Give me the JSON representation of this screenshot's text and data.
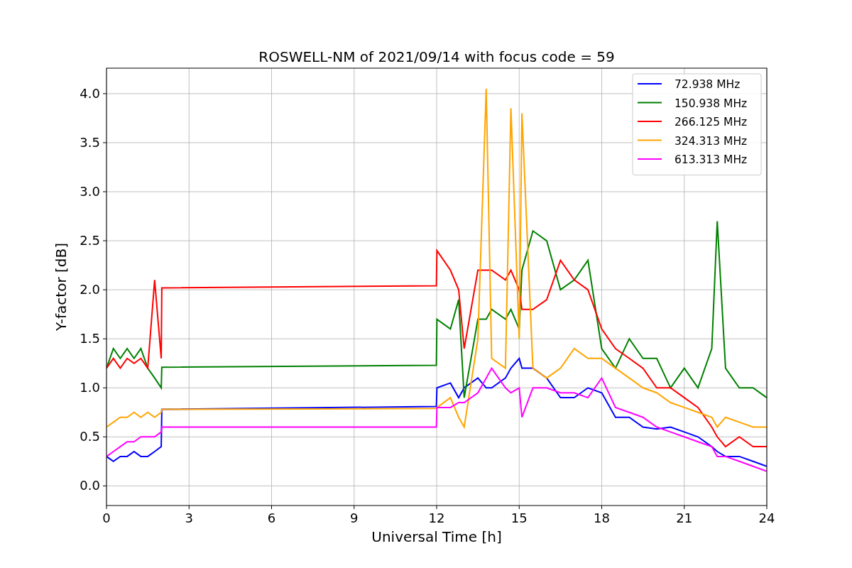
{
  "chart_data": {
    "type": "line",
    "title": "ROSWELL-NM of 2021/09/14 with focus code = 59",
    "xlabel": "Universal Time [h]",
    "ylabel": "Y-factor [dB]",
    "x": [
      0,
      0.25,
      0.5,
      0.75,
      1,
      1.25,
      1.5,
      1.75,
      1.99,
      2.01,
      11.99,
      12.01,
      12.5,
      12.8,
      13,
      13.5,
      13.8,
      14,
      14.5,
      14.7,
      15,
      15.1,
      15.5,
      16,
      16.5,
      17,
      17.5,
      18,
      18.5,
      19,
      19.5,
      20,
      20.5,
      21,
      21.5,
      22,
      22.2,
      22.5,
      23,
      23.5,
      24
    ],
    "series": [
      {
        "name": "72.938 MHz",
        "color": "#0000ff",
        "values": [
          0.3,
          0.25,
          0.3,
          0.3,
          0.35,
          0.3,
          0.3,
          0.35,
          0.4,
          0.78,
          0.81,
          1.0,
          1.05,
          0.9,
          1.0,
          1.1,
          1.0,
          1.0,
          1.1,
          1.2,
          1.3,
          1.2,
          1.2,
          1.1,
          0.9,
          0.9,
          1.0,
          0.95,
          0.7,
          0.7,
          0.6,
          0.58,
          0.6,
          0.55,
          0.5,
          0.4,
          0.35,
          0.3,
          0.3,
          0.25,
          0.2
        ]
      },
      {
        "name": "150.938 MHz",
        "color": "#008000",
        "values": [
          1.2,
          1.4,
          1.3,
          1.4,
          1.3,
          1.4,
          1.2,
          1.1,
          1.0,
          1.21,
          1.23,
          1.7,
          1.6,
          1.9,
          0.9,
          1.7,
          1.7,
          1.8,
          1.7,
          1.8,
          1.6,
          2.2,
          2.6,
          2.5,
          2.0,
          2.1,
          2.3,
          1.4,
          1.2,
          1.5,
          1.3,
          1.3,
          1.0,
          1.2,
          1.0,
          1.4,
          2.7,
          1.2,
          1.0,
          1.0,
          0.9
        ]
      },
      {
        "name": "266.125 MHz",
        "color": "#ff0000",
        "values": [
          1.2,
          1.3,
          1.2,
          1.3,
          1.25,
          1.3,
          1.2,
          2.1,
          1.3,
          2.02,
          2.04,
          2.4,
          2.2,
          2.0,
          1.4,
          2.2,
          2.2,
          2.2,
          2.1,
          2.2,
          2.0,
          1.8,
          1.8,
          1.9,
          2.3,
          2.1,
          2.0,
          1.6,
          1.4,
          1.3,
          1.2,
          1.0,
          1.0,
          0.9,
          0.8,
          0.6,
          0.5,
          0.4,
          0.5,
          0.4,
          0.4
        ]
      },
      {
        "name": "324.313 MHz",
        "color": "#ffa500",
        "values": [
          0.6,
          0.65,
          0.7,
          0.7,
          0.75,
          0.7,
          0.75,
          0.7,
          0.75,
          0.78,
          0.79,
          0.8,
          0.9,
          0.7,
          0.6,
          1.5,
          4.05,
          1.3,
          1.2,
          3.85,
          1.5,
          3.8,
          1.2,
          1.1,
          1.2,
          1.4,
          1.3,
          1.3,
          1.2,
          1.1,
          1.0,
          0.95,
          0.85,
          0.8,
          0.75,
          0.7,
          0.6,
          0.7,
          0.65,
          0.6,
          0.6
        ]
      },
      {
        "name": "613.313 MHz",
        "color": "#ff00ff",
        "values": [
          0.3,
          0.35,
          0.4,
          0.45,
          0.45,
          0.5,
          0.5,
          0.5,
          0.55,
          0.6,
          0.6,
          0.8,
          0.8,
          0.85,
          0.85,
          0.95,
          1.1,
          1.2,
          1.0,
          0.95,
          1.0,
          0.7,
          1.0,
          1.0,
          0.95,
          0.95,
          0.9,
          1.1,
          0.8,
          0.75,
          0.7,
          0.6,
          0.55,
          0.5,
          0.45,
          0.4,
          0.3,
          0.3,
          0.25,
          0.2,
          0.15
        ]
      }
    ],
    "grid": true,
    "legend": true,
    "xlim": [
      0,
      24
    ],
    "ylim": [
      -0.2,
      4.26
    ],
    "xticks": [
      0,
      3,
      6,
      9,
      12,
      15,
      18,
      21,
      24
    ],
    "yticks": [
      {
        "value": 0,
        "label": "0.0"
      },
      {
        "value": 0.5,
        "label": "0.5"
      },
      {
        "value": 1,
        "label": "1.0"
      },
      {
        "value": 1.5,
        "label": "1.5"
      },
      {
        "value": 2,
        "label": "2.0"
      },
      {
        "value": 2.5,
        "label": "2.5"
      },
      {
        "value": 3,
        "label": "3.0"
      },
      {
        "value": 3.5,
        "label": "3.5"
      },
      {
        "value": 4,
        "label": "4.0"
      }
    ]
  }
}
